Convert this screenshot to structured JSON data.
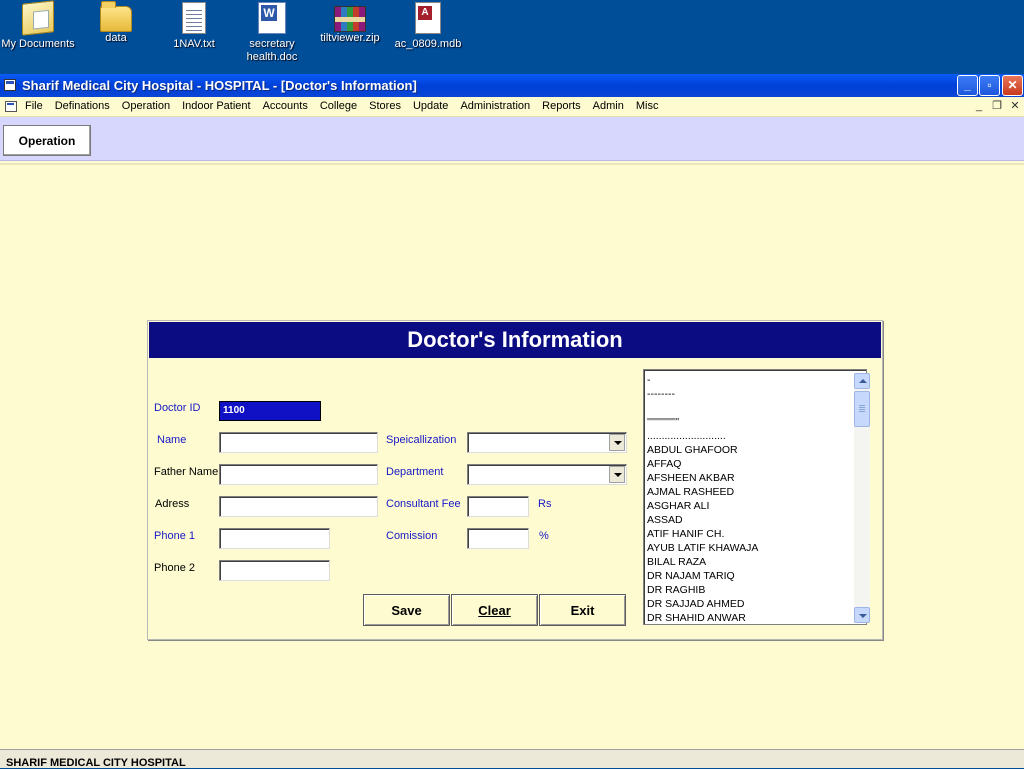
{
  "desktop": {
    "icons": [
      {
        "label": "My Documents",
        "icon": "my-documents-icon"
      },
      {
        "label": "data",
        "icon": "folder-icon"
      },
      {
        "label": "1NAV.txt",
        "icon": "text-file-icon"
      },
      {
        "label": "secretary health.doc",
        "icon": "word-document-icon"
      },
      {
        "label": "tiltviewer.zip",
        "icon": "zip-archive-icon"
      },
      {
        "label": "ac_0809.mdb",
        "icon": "access-database-icon"
      }
    ]
  },
  "window": {
    "title": "Sharif Medical City Hospital - HOSPITAL - [Doctor's Information]",
    "controls": {
      "minimize": "_",
      "maximize": "▫",
      "close": "✕"
    }
  },
  "menu": {
    "items": [
      "File",
      "Definations",
      "Operation",
      "Indoor Patient",
      "Accounts",
      "College",
      "Stores",
      "Update",
      "Administration",
      "Reports",
      "Admin",
      "Misc"
    ],
    "mdi": {
      "minimize": "_",
      "restore": "❐",
      "close": "✕"
    }
  },
  "toolbar": {
    "operation_label": "Operation"
  },
  "form": {
    "title": "Doctor's Information",
    "labels": {
      "doctor_id": "Doctor ID",
      "name": "Name",
      "father_name": "Father Name",
      "address": "Adress",
      "phone1": "Phone 1",
      "phone2": "Phone 2",
      "specialization": "Speicallization",
      "department": "Department",
      "consultant_fee": "Consultant Fee",
      "commission": "Comission",
      "fee_unit": "Rs",
      "commission_unit": "%"
    },
    "values": {
      "doctor_id": "1100",
      "name": "",
      "father_name": "",
      "address": "",
      "phone1": "",
      "phone2": "",
      "specialization": "",
      "department": "",
      "consultant_fee": "",
      "commission": ""
    },
    "buttons": {
      "save": "Save",
      "clear": "Clear",
      "exit": "Exit"
    },
    "doctor_list": [
      "-",
      "--------",
      "",
      "''''''''''''''''",
      "...........................",
      "ABDUL GHAFOOR",
      "AFFAQ",
      "AFSHEEN AKBAR",
      "AJMAL RASHEED",
      "ASGHAR ALI",
      "ASSAD",
      "ATIF HANIF CH.",
      "AYUB LATIF KHAWAJA",
      "BILAL RAZA",
      "DR NAJAM TARIQ",
      "DR RAGHIB",
      "DR SAJJAD AHMED",
      "DR SHAHID ANWAR"
    ]
  },
  "status": {
    "text": "SHARIF MEDICAL CITY HOSPITAL"
  }
}
